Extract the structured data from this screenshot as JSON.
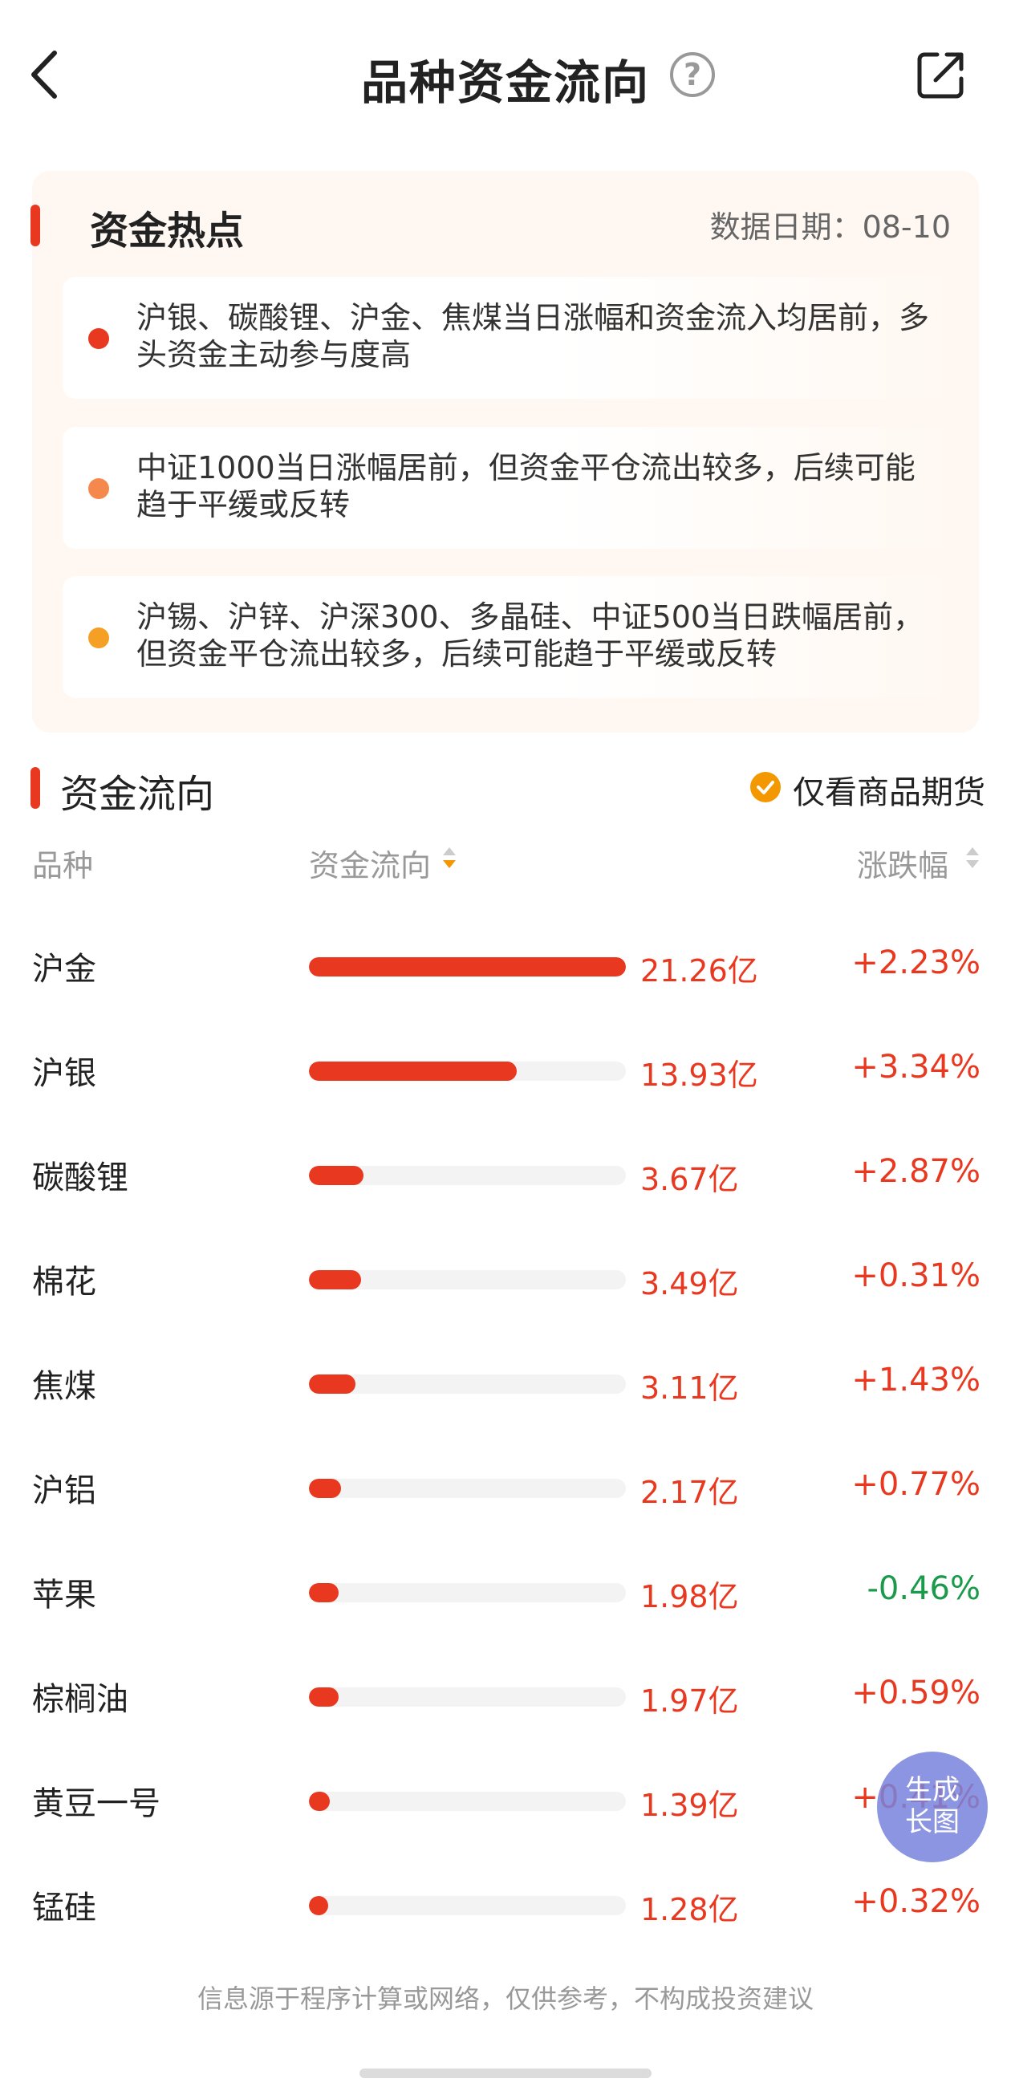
{
  "header": {
    "title": "品种资金流向",
    "help_glyph": "?"
  },
  "hot": {
    "title": "资金热点",
    "date": "数据日期：08-10",
    "items": [
      {
        "text": "沪银、碳酸锂、沪金、焦煤当日涨幅和资金流入均居前，多头资金主动参与度高",
        "dot_color": "#e8381f"
      },
      {
        "text": "中证1000当日涨幅居前，但资金平仓流出较多，后续可能趋于平缓或反转",
        "dot_color": "#f5894d"
      },
      {
        "text": "沪锡、沪锌、沪深300、多晶硅、中证500当日跌幅居前，但资金平仓流出较多，后续可能趋于平缓或反转",
        "dot_color": "#f5a024"
      }
    ]
  },
  "flow": {
    "title": "资金流向",
    "filter_label": "仅看商品期货",
    "columns": {
      "name": "品种",
      "flow": "资金流向",
      "change": "涨跌幅"
    },
    "rows": [
      {
        "name": "沪金",
        "amount": "21.26亿",
        "fill": 1.0,
        "change": "+2.23%",
        "up": true
      },
      {
        "name": "沪银",
        "amount": "13.93亿",
        "fill": 0.655,
        "change": "+3.34%",
        "up": true
      },
      {
        "name": "碳酸锂",
        "amount": "3.67亿",
        "fill": 0.173,
        "change": "+2.87%",
        "up": true
      },
      {
        "name": "棉花",
        "amount": "3.49亿",
        "fill": 0.164,
        "change": "+0.31%",
        "up": true
      },
      {
        "name": "焦煤",
        "amount": "3.11亿",
        "fill": 0.146,
        "change": "+1.43%",
        "up": true
      },
      {
        "name": "沪铝",
        "amount": "2.17亿",
        "fill": 0.102,
        "change": "+0.77%",
        "up": true
      },
      {
        "name": "苹果",
        "amount": "1.98亿",
        "fill": 0.093,
        "change": "-0.46%",
        "up": false
      },
      {
        "name": "棕榈油",
        "amount": "1.97亿",
        "fill": 0.093,
        "change": "+0.59%",
        "up": true
      },
      {
        "name": "黄豆一号",
        "amount": "1.39亿",
        "fill": 0.065,
        "change": "+0.41%",
        "up": true
      },
      {
        "name": "锰硅",
        "amount": "1.28亿",
        "fill": 0.06,
        "change": "+0.32%",
        "up": true
      }
    ]
  },
  "float_button": {
    "line1": "生成",
    "line2": "长图"
  },
  "disclaimer": "信息源于程序计算或网络，仅供参考，不构成投资建议",
  "colors": {
    "up": "#e8381f",
    "down": "#1a9a4a",
    "accent": "#e8381f",
    "check": "#f39800"
  },
  "icons": {
    "back": "chevron-left-icon",
    "help": "question-circle-icon",
    "share": "share-export-icon",
    "check": "checkmark-circle-icon",
    "sort": "sort-arrows-icon"
  }
}
